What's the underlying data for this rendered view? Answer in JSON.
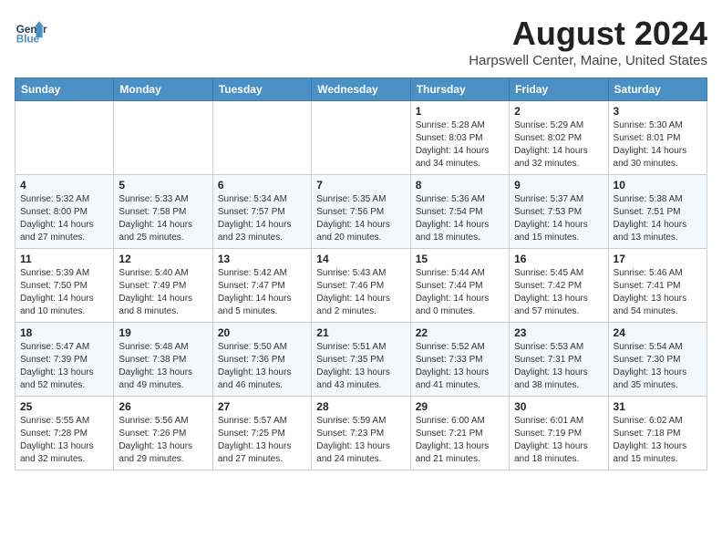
{
  "header": {
    "logo_line1": "General",
    "logo_line2": "Blue",
    "month": "August 2024",
    "location": "Harpswell Center, Maine, United States"
  },
  "days_of_week": [
    "Sunday",
    "Monday",
    "Tuesday",
    "Wednesday",
    "Thursday",
    "Friday",
    "Saturday"
  ],
  "weeks": [
    [
      {
        "day": "",
        "info": ""
      },
      {
        "day": "",
        "info": ""
      },
      {
        "day": "",
        "info": ""
      },
      {
        "day": "",
        "info": ""
      },
      {
        "day": "1",
        "info": "Sunrise: 5:28 AM\nSunset: 8:03 PM\nDaylight: 14 hours\nand 34 minutes."
      },
      {
        "day": "2",
        "info": "Sunrise: 5:29 AM\nSunset: 8:02 PM\nDaylight: 14 hours\nand 32 minutes."
      },
      {
        "day": "3",
        "info": "Sunrise: 5:30 AM\nSunset: 8:01 PM\nDaylight: 14 hours\nand 30 minutes."
      }
    ],
    [
      {
        "day": "4",
        "info": "Sunrise: 5:32 AM\nSunset: 8:00 PM\nDaylight: 14 hours\nand 27 minutes."
      },
      {
        "day": "5",
        "info": "Sunrise: 5:33 AM\nSunset: 7:58 PM\nDaylight: 14 hours\nand 25 minutes."
      },
      {
        "day": "6",
        "info": "Sunrise: 5:34 AM\nSunset: 7:57 PM\nDaylight: 14 hours\nand 23 minutes."
      },
      {
        "day": "7",
        "info": "Sunrise: 5:35 AM\nSunset: 7:56 PM\nDaylight: 14 hours\nand 20 minutes."
      },
      {
        "day": "8",
        "info": "Sunrise: 5:36 AM\nSunset: 7:54 PM\nDaylight: 14 hours\nand 18 minutes."
      },
      {
        "day": "9",
        "info": "Sunrise: 5:37 AM\nSunset: 7:53 PM\nDaylight: 14 hours\nand 15 minutes."
      },
      {
        "day": "10",
        "info": "Sunrise: 5:38 AM\nSunset: 7:51 PM\nDaylight: 14 hours\nand 13 minutes."
      }
    ],
    [
      {
        "day": "11",
        "info": "Sunrise: 5:39 AM\nSunset: 7:50 PM\nDaylight: 14 hours\nand 10 minutes."
      },
      {
        "day": "12",
        "info": "Sunrise: 5:40 AM\nSunset: 7:49 PM\nDaylight: 14 hours\nand 8 minutes."
      },
      {
        "day": "13",
        "info": "Sunrise: 5:42 AM\nSunset: 7:47 PM\nDaylight: 14 hours\nand 5 minutes."
      },
      {
        "day": "14",
        "info": "Sunrise: 5:43 AM\nSunset: 7:46 PM\nDaylight: 14 hours\nand 2 minutes."
      },
      {
        "day": "15",
        "info": "Sunrise: 5:44 AM\nSunset: 7:44 PM\nDaylight: 14 hours\nand 0 minutes."
      },
      {
        "day": "16",
        "info": "Sunrise: 5:45 AM\nSunset: 7:42 PM\nDaylight: 13 hours\nand 57 minutes."
      },
      {
        "day": "17",
        "info": "Sunrise: 5:46 AM\nSunset: 7:41 PM\nDaylight: 13 hours\nand 54 minutes."
      }
    ],
    [
      {
        "day": "18",
        "info": "Sunrise: 5:47 AM\nSunset: 7:39 PM\nDaylight: 13 hours\nand 52 minutes."
      },
      {
        "day": "19",
        "info": "Sunrise: 5:48 AM\nSunset: 7:38 PM\nDaylight: 13 hours\nand 49 minutes."
      },
      {
        "day": "20",
        "info": "Sunrise: 5:50 AM\nSunset: 7:36 PM\nDaylight: 13 hours\nand 46 minutes."
      },
      {
        "day": "21",
        "info": "Sunrise: 5:51 AM\nSunset: 7:35 PM\nDaylight: 13 hours\nand 43 minutes."
      },
      {
        "day": "22",
        "info": "Sunrise: 5:52 AM\nSunset: 7:33 PM\nDaylight: 13 hours\nand 41 minutes."
      },
      {
        "day": "23",
        "info": "Sunrise: 5:53 AM\nSunset: 7:31 PM\nDaylight: 13 hours\nand 38 minutes."
      },
      {
        "day": "24",
        "info": "Sunrise: 5:54 AM\nSunset: 7:30 PM\nDaylight: 13 hours\nand 35 minutes."
      }
    ],
    [
      {
        "day": "25",
        "info": "Sunrise: 5:55 AM\nSunset: 7:28 PM\nDaylight: 13 hours\nand 32 minutes."
      },
      {
        "day": "26",
        "info": "Sunrise: 5:56 AM\nSunset: 7:26 PM\nDaylight: 13 hours\nand 29 minutes."
      },
      {
        "day": "27",
        "info": "Sunrise: 5:57 AM\nSunset: 7:25 PM\nDaylight: 13 hours\nand 27 minutes."
      },
      {
        "day": "28",
        "info": "Sunrise: 5:59 AM\nSunset: 7:23 PM\nDaylight: 13 hours\nand 24 minutes."
      },
      {
        "day": "29",
        "info": "Sunrise: 6:00 AM\nSunset: 7:21 PM\nDaylight: 13 hours\nand 21 minutes."
      },
      {
        "day": "30",
        "info": "Sunrise: 6:01 AM\nSunset: 7:19 PM\nDaylight: 13 hours\nand 18 minutes."
      },
      {
        "day": "31",
        "info": "Sunrise: 6:02 AM\nSunset: 7:18 PM\nDaylight: 13 hours\nand 15 minutes."
      }
    ]
  ]
}
